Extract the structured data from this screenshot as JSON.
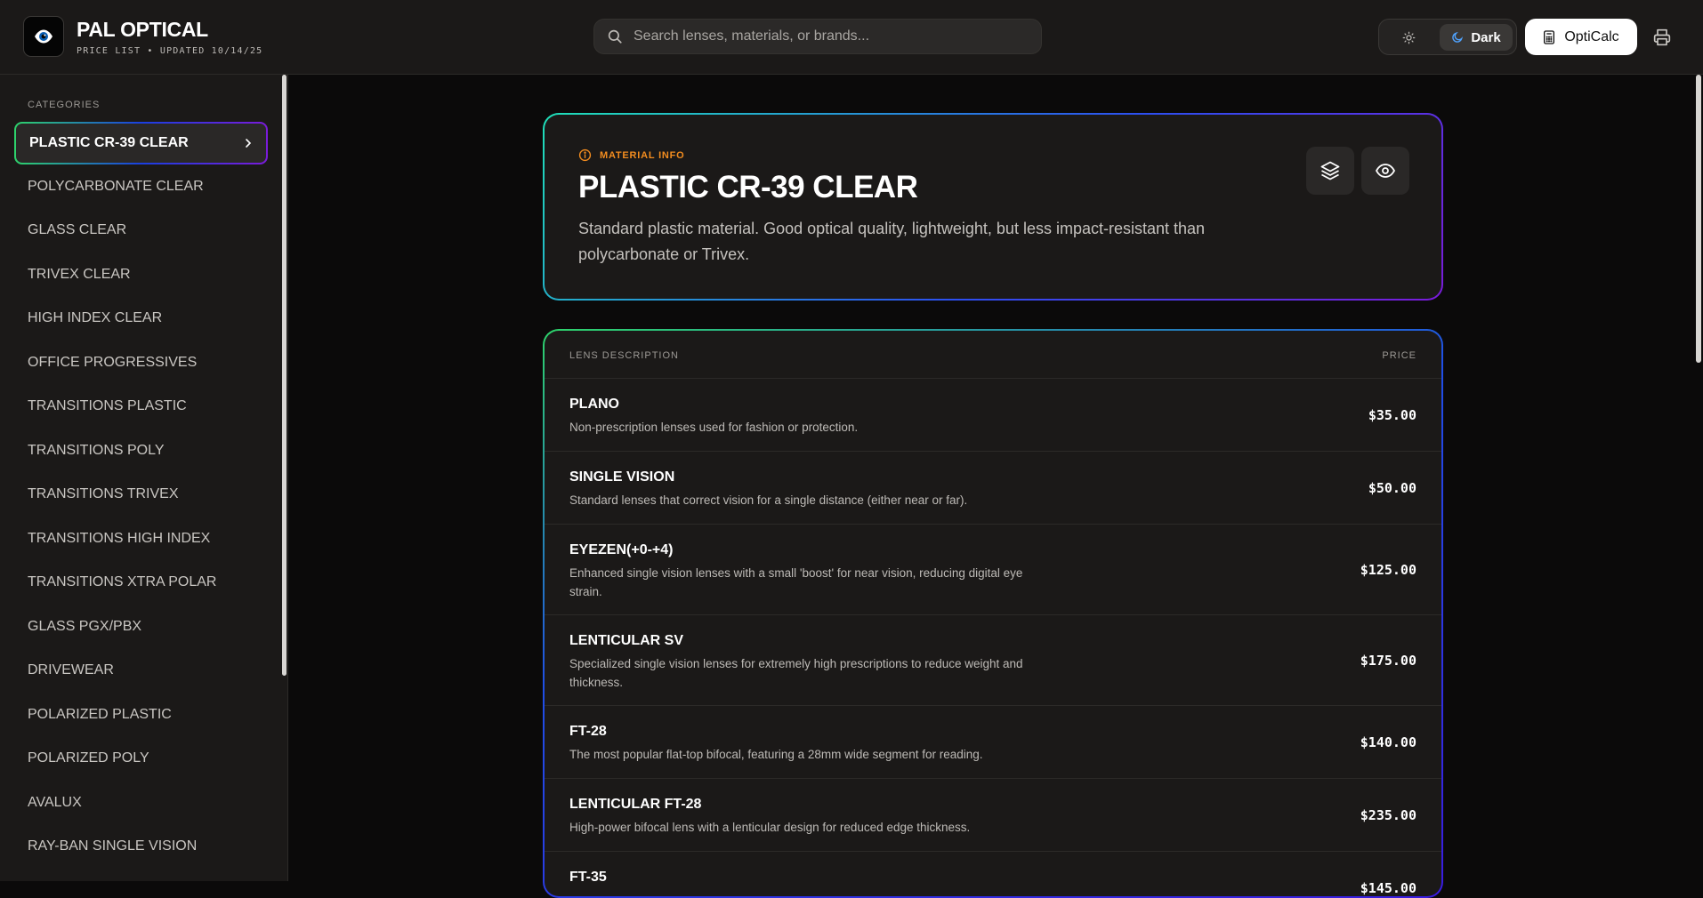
{
  "header": {
    "title": "PAL OPTICAL",
    "subtitle": "PRICE LIST • UPDATED 10/14/25",
    "search_placeholder": "Search lenses, materials, or brands...",
    "theme_dark_label": "Dark",
    "opticalc_label": "OptiCalc"
  },
  "sidebar": {
    "heading": "CATEGORIES",
    "items": [
      {
        "label": "PLASTIC CR-39 CLEAR",
        "active": true
      },
      {
        "label": "POLYCARBONATE CLEAR"
      },
      {
        "label": "GLASS CLEAR"
      },
      {
        "label": "TRIVEX CLEAR"
      },
      {
        "label": "HIGH INDEX CLEAR"
      },
      {
        "label": "OFFICE PROGRESSIVES"
      },
      {
        "label": "TRANSITIONS PLASTIC"
      },
      {
        "label": "TRANSITIONS POLY"
      },
      {
        "label": "TRANSITIONS TRIVEX"
      },
      {
        "label": "TRANSITIONS HIGH INDEX"
      },
      {
        "label": "TRANSITIONS XTRA POLAR"
      },
      {
        "label": "GLASS PGX/PBX"
      },
      {
        "label": "DRIVEWEAR"
      },
      {
        "label": "POLARIZED PLASTIC"
      },
      {
        "label": "POLARIZED POLY"
      },
      {
        "label": "AVALUX"
      },
      {
        "label": "RAY-BAN SINGLE VISION"
      }
    ]
  },
  "material": {
    "tag": "MATERIAL INFO",
    "title": "PLASTIC CR-39 CLEAR",
    "description": "Standard plastic material. Good optical quality, lightweight, but less impact-resistant than polycarbonate or Trivex."
  },
  "table": {
    "col_description": "LENS DESCRIPTION",
    "col_price": "PRICE",
    "rows": [
      {
        "name": "PLANO",
        "desc": "Non-prescription lenses used for fashion or protection.",
        "price": "$35.00"
      },
      {
        "name": "SINGLE VISION",
        "desc": "Standard lenses that correct vision for a single distance (either near or far).",
        "price": "$50.00"
      },
      {
        "name": "EYEZEN(+0-+4)",
        "desc": "Enhanced single vision lenses with a small 'boost' for near vision, reducing digital eye strain.",
        "price": "$125.00"
      },
      {
        "name": "LENTICULAR SV",
        "desc": "Specialized single vision lenses for extremely high prescriptions to reduce weight and thickness.",
        "price": "$175.00"
      },
      {
        "name": "FT-28",
        "desc": "The most popular flat-top bifocal, featuring a 28mm wide segment for reading.",
        "price": "$140.00"
      },
      {
        "name": "LENTICULAR FT-28",
        "desc": "High-power bifocal lens with a lenticular design for reduced edge thickness.",
        "price": "$235.00"
      },
      {
        "name": "FT-35",
        "desc": "",
        "price": "$145.00"
      }
    ]
  },
  "colors": {
    "accent_orange": "#f28c1f",
    "gradient_green": "#2ed36b",
    "gradient_blue": "#1f4fe6",
    "gradient_purple": "#7a1bd9"
  }
}
